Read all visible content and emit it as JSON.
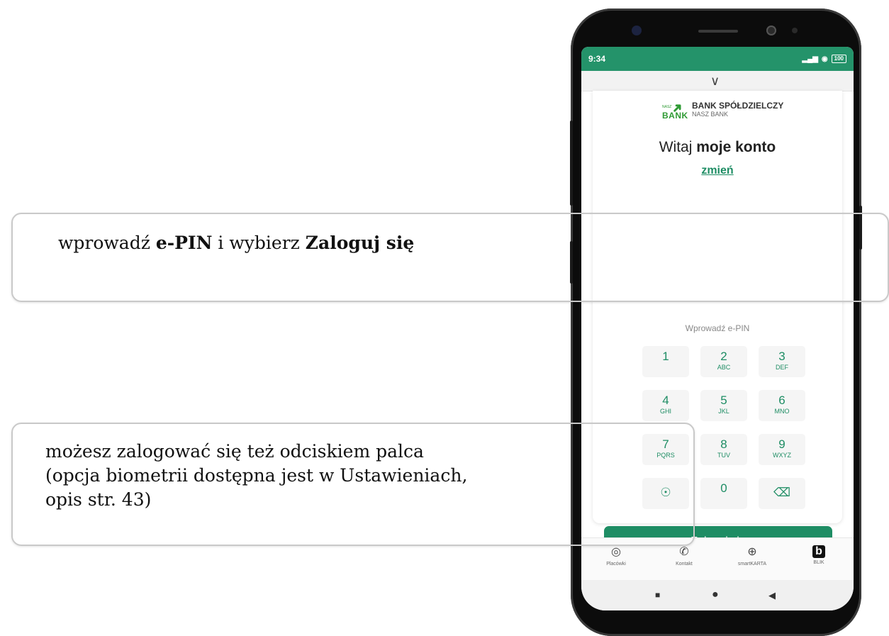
{
  "callouts": {
    "top": {
      "pre": "wprowadź ",
      "b1": "e-PIN",
      "mid": " i wybierz ",
      "b2": "Zaloguj się"
    },
    "bottom": {
      "line1": "możesz zalogować się też odciskiem palca",
      "line2": "(opcja biometrii dostępna jest w Ustawieniach,",
      "line3": "opis str. 43)"
    }
  },
  "status": {
    "time": "9:34",
    "signal": "▂▄▆",
    "wifi": "◉",
    "battery": "100"
  },
  "sheet": {
    "chevron": "∨"
  },
  "logo": {
    "small": "NASZ",
    "mark": "BANK",
    "title": "BANK SPÓŁDZIELCZY",
    "subtitle": "NASZ BANK"
  },
  "welcome": {
    "pre": "Witaj ",
    "name": "moje konto",
    "change": "zmień"
  },
  "pin": {
    "label": "Wprowadź e-PIN"
  },
  "keypad": {
    "k1": {
      "digit": "1",
      "letters": ""
    },
    "k2": {
      "digit": "2",
      "letters": "ABC"
    },
    "k3": {
      "digit": "3",
      "letters": "DEF"
    },
    "k4": {
      "digit": "4",
      "letters": "GHI"
    },
    "k5": {
      "digit": "5",
      "letters": "JKL"
    },
    "k6": {
      "digit": "6",
      "letters": "MNO"
    },
    "k7": {
      "digit": "7",
      "letters": "PQRS"
    },
    "k8": {
      "digit": "8",
      "letters": "TUV"
    },
    "k9": {
      "digit": "9",
      "letters": "WXYZ"
    },
    "k0": {
      "digit": "0",
      "letters": ""
    },
    "fingerprint_icon": "☉",
    "backspace_icon": "⌫"
  },
  "login_button": "Zaloguj się",
  "bottom_nav": [
    {
      "icon": "◎",
      "label": "Placówki"
    },
    {
      "icon": "✆",
      "label": "Kontakt"
    },
    {
      "icon": "⊕",
      "label": "smartKARTA"
    },
    {
      "icon": "b",
      "label": "BLIK"
    }
  ],
  "system_nav": {
    "recents": "■",
    "home": "●",
    "back": "◀"
  },
  "colors": {
    "accent": "#1e8d64",
    "status_bar": "#24936a",
    "logo_green": "#2e9a33"
  }
}
